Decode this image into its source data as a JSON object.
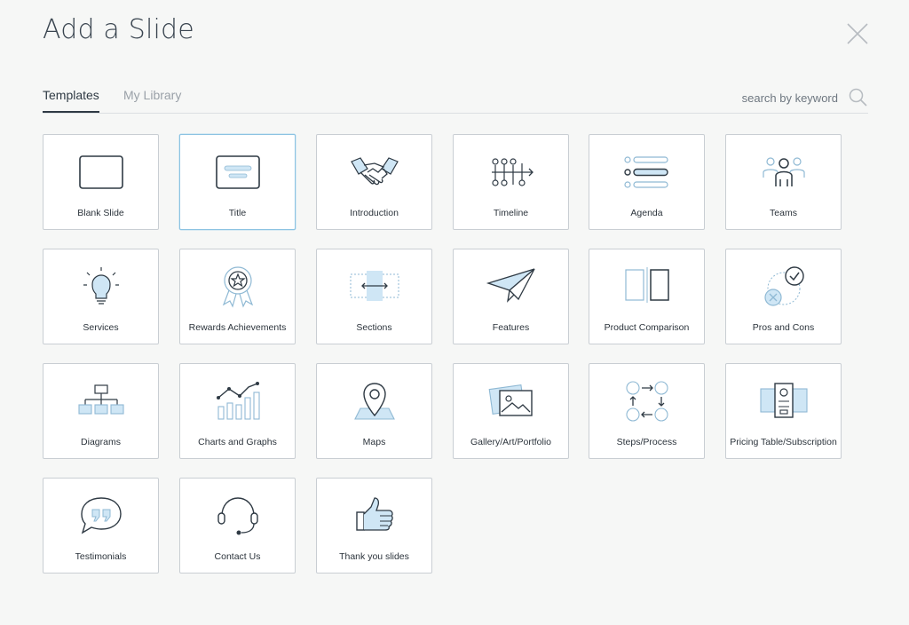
{
  "dialog": {
    "title": "Add a Slide"
  },
  "tabs": [
    {
      "label": "Templates",
      "active": true
    },
    {
      "label": "My Library",
      "active": false
    }
  ],
  "search": {
    "placeholder": "search by keyword",
    "value": ""
  },
  "templates": [
    {
      "label": "Blank Slide",
      "icon": "blank-slide-icon"
    },
    {
      "label": "Title",
      "icon": "title-slide-icon",
      "selected": true
    },
    {
      "label": "Introduction",
      "icon": "handshake-icon"
    },
    {
      "label": "Timeline",
      "icon": "timeline-icon"
    },
    {
      "label": "Agenda",
      "icon": "agenda-list-icon"
    },
    {
      "label": "Teams",
      "icon": "team-people-icon"
    },
    {
      "label": "Services",
      "icon": "lightbulb-icon"
    },
    {
      "label": "Rewards Achievements",
      "icon": "award-ribbon-icon"
    },
    {
      "label": "Sections",
      "icon": "sections-icon"
    },
    {
      "label": "Features",
      "icon": "paper-plane-icon"
    },
    {
      "label": "Product Comparison",
      "icon": "comparison-icon"
    },
    {
      "label": "Pros and Cons",
      "icon": "check-cross-icon"
    },
    {
      "label": "Diagrams",
      "icon": "org-chart-icon"
    },
    {
      "label": "Charts and Graphs",
      "icon": "bar-line-chart-icon"
    },
    {
      "label": "Maps",
      "icon": "map-pin-icon"
    },
    {
      "label": "Gallery/Art/Portfolio",
      "icon": "picture-gallery-icon"
    },
    {
      "label": "Steps/Process",
      "icon": "process-cycle-icon"
    },
    {
      "label": "Pricing Table/Subscription",
      "icon": "pricing-table-icon"
    },
    {
      "label": "Testimonials",
      "icon": "quote-bubble-icon"
    },
    {
      "label": "Contact Us",
      "icon": "headset-icon"
    },
    {
      "label": "Thank you slides",
      "icon": "thumbs-up-icon"
    }
  ],
  "colors": {
    "accent_light": "#cfe6f5",
    "icon_stroke": "#2f3a44",
    "selected_border": "#8cc3e2"
  }
}
